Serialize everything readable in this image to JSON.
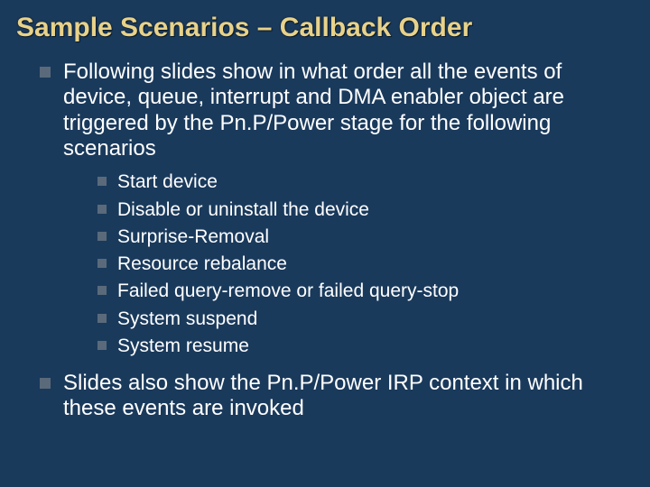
{
  "title": "Sample Scenarios – Callback Order",
  "intro": "Following slides show in what order all the events of device, queue, interrupt and DMA enabler object are triggered by the Pn.P/Power stage for the following scenarios",
  "scenarios": [
    "Start device",
    "Disable or uninstall the device",
    "Surprise-Removal",
    "Resource rebalance",
    "Failed query-remove or failed query-stop",
    "System suspend",
    "System resume"
  ],
  "closing": "Slides also show the Pn.P/Power IRP context in which these events are invoked"
}
